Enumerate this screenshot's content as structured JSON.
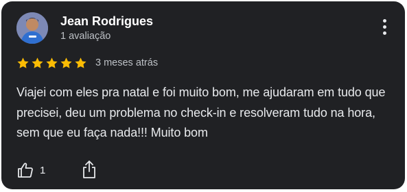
{
  "review": {
    "reviewer_name": "Jean Rodrigues",
    "review_count_label": "1 avaliação",
    "rating": 5,
    "rating_max": 5,
    "time_ago": "3 meses atrás",
    "text": "Viajei com eles pra natal e foi muito bom, me ajudaram em tudo que precisei, deu um problema no check-in e resolveram tudo na hora, sem que eu faça nada!!! Muito bom",
    "like_count": "1"
  },
  "icons": {
    "menu": "more-vert-icon",
    "star": "star-icon",
    "like": "thumb-up-icon",
    "share": "share-icon",
    "avatar": "avatar"
  },
  "colors": {
    "card_background": "#202124",
    "star": "#fbbc04",
    "primary_text": "#e8eaed",
    "secondary_text": "#bdc1c6"
  }
}
